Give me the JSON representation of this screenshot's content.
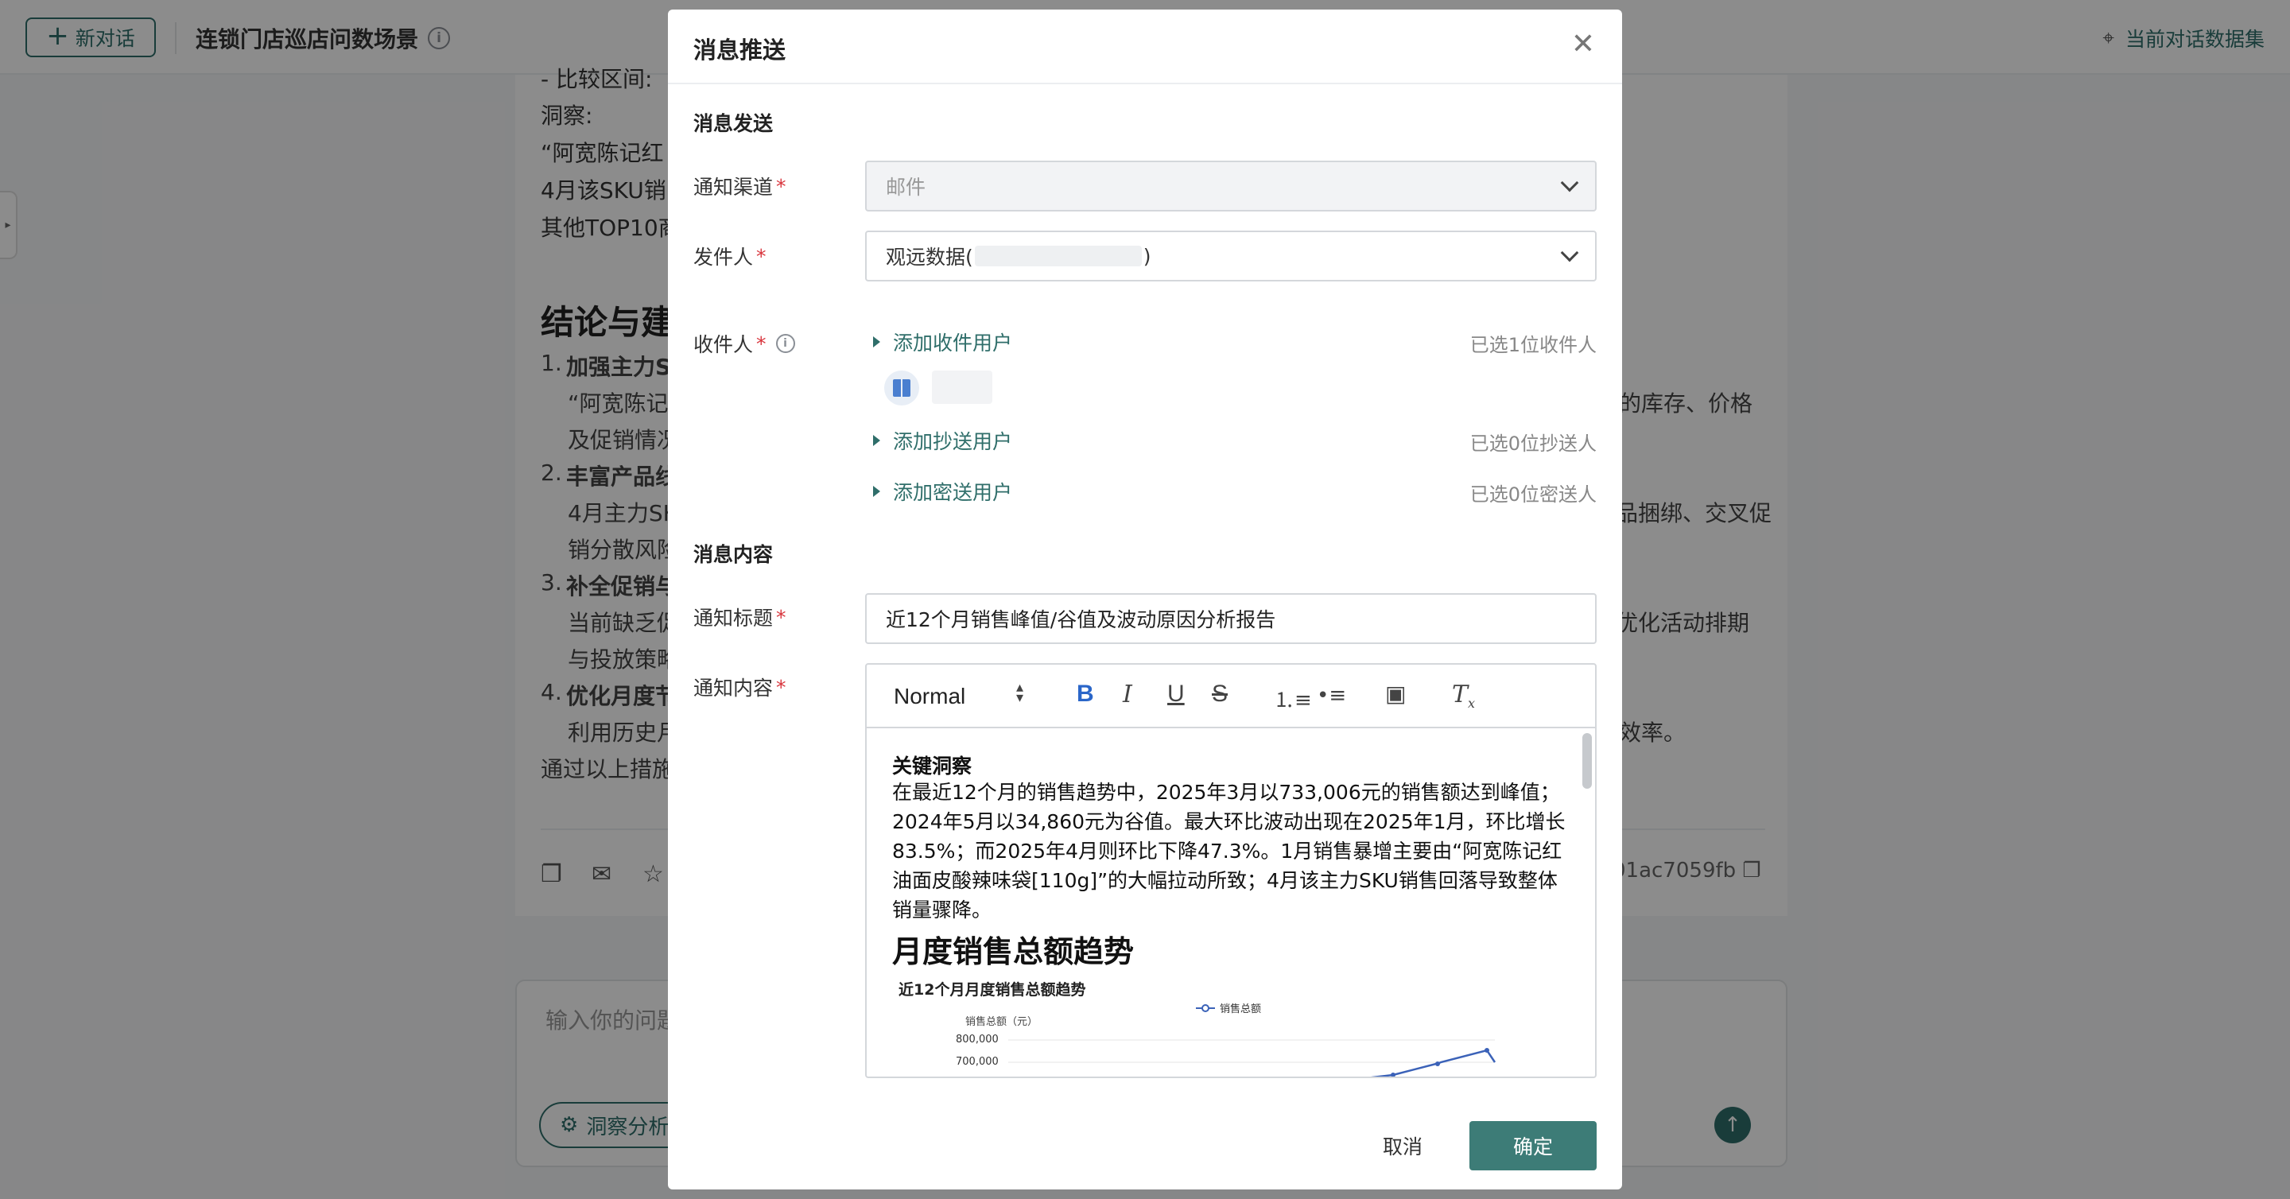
{
  "topbar": {
    "new_chat": "新对话",
    "scene_title": "连锁门店巡店问数场景",
    "dataset_link": "当前对话数据集"
  },
  "background": {
    "lines": [
      "- 比较区间:",
      "洞察:",
      "“阿宽陈记红",
      "4月该SKU销",
      "其他TOP10商"
    ],
    "heading": "结论与建",
    "items": [
      {
        "num": "1.",
        "title": "加强主力S",
        "text": "“阿宽陈记",
        "tail": "的库存、价格",
        "cont": "及促销情况"
      },
      {
        "num": "2.",
        "title": "丰富产品线",
        "text": "4月主力SK",
        "tail": "品捆绑、交叉促",
        "cont": "销分散风险"
      },
      {
        "num": "3.",
        "title": "补全促销与",
        "text": "当前缺乏促",
        "tail": "优化活动排期",
        "cont": "与投放策略"
      },
      {
        "num": "4.",
        "title": "优化月度节",
        "text": "利用历史月",
        "tail": "效率。"
      }
    ],
    "closing": "通过以上措施",
    "hash": "01ac7059fb",
    "input_placeholder": "输入你的问题",
    "insight_chip": "洞察分析"
  },
  "modal": {
    "title": "消息推送",
    "section_send": "消息发送",
    "channel_label": "通知渠道",
    "channel_value": "邮件",
    "sender_label": "发件人",
    "sender_prefix": "观远数据(",
    "sender_suffix": ")",
    "recipient_label": "收件人",
    "add_recipient": "添加收件用户",
    "recipient_count": "已选1位收件人",
    "add_cc": "添加抄送用户",
    "cc_count": "已选0位抄送人",
    "add_bcc": "添加密送用户",
    "bcc_count": "已选0位密送人",
    "section_content": "消息内容",
    "subject_label": "通知标题",
    "subject_value": "近12个月销售峰值/谷值及波动原因分析报告",
    "body_label": "通知内容",
    "toolbar": {
      "format": "Normal"
    },
    "body": {
      "heading": "关键洞察",
      "paragraph": "在最近12个月的销售趋势中，2025年3月以733,006元的销售额达到峰值；2024年5月以34,860元为谷值。最大环比波动出现在2025年1月，环比增长83.5%；而2025年4月则环比下降47.3%。1月销售暴增主要由“阿宽陈记红油面皮酸辣味袋[110g]”的大幅拉动所致；4月该主力SKU销售回落导致整体销量骤降。",
      "h1": "月度销售总额趋势",
      "chart_title": "近12个月月度销售总额趋势",
      "legend": "销售总额",
      "ylabel": "销售总额（元）",
      "yticks": [
        "800,000",
        "700,000"
      ]
    },
    "cancel": "取消",
    "ok": "确定"
  },
  "chart_data": {
    "type": "line",
    "title": "近12个月月度销售总额趋势",
    "ylabel": "销售总额（元）",
    "series": [
      {
        "name": "销售总额"
      }
    ],
    "yticks": [
      800000,
      700000
    ],
    "visible_points_note_values": [
      680000,
      700000,
      733006,
      690000
    ]
  }
}
